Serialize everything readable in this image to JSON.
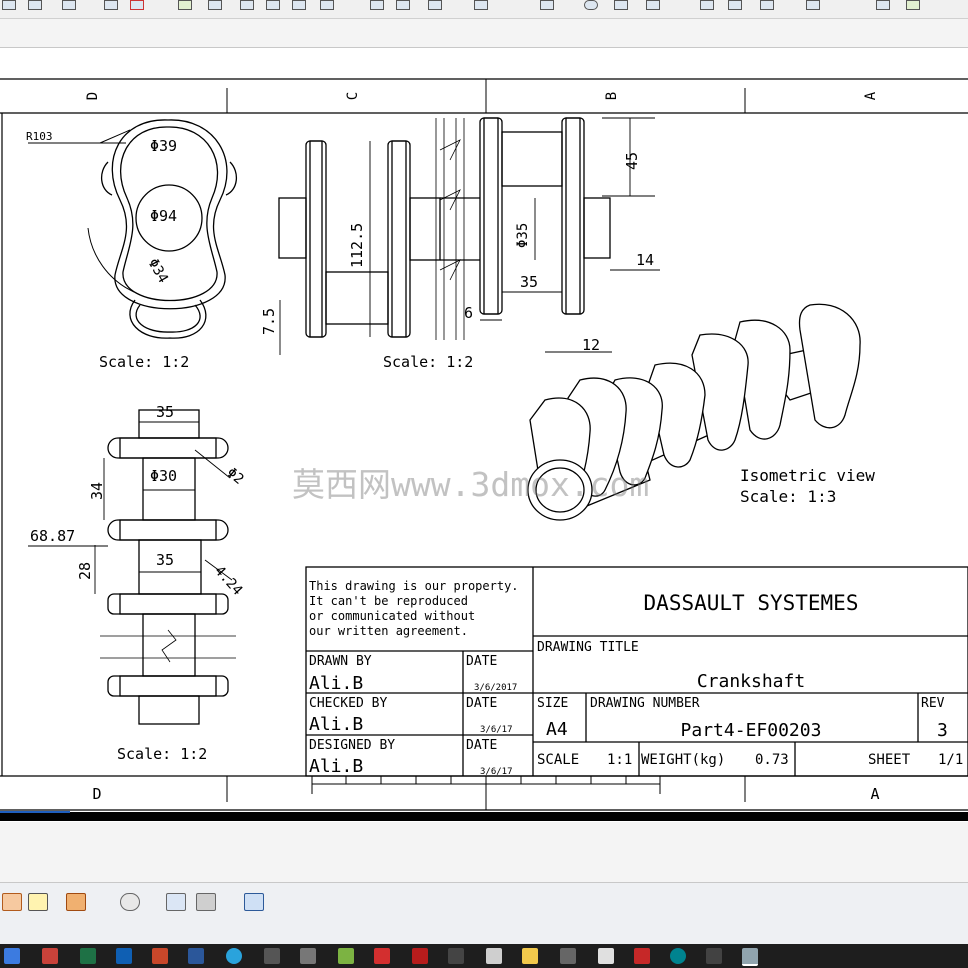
{
  "window": {
    "accent": "#1f5fbf"
  },
  "toolbar": {
    "icons": [
      "new-icon",
      "open-icon",
      "save-icon",
      "select-icon",
      "arrow-icon",
      "zoom-icon",
      "pan-icon",
      "rotate-icon",
      "view-icon",
      "measure-icon",
      "dimension-icon",
      "section-icon",
      "line-icon",
      "undo-icon",
      "copy-icon",
      "snap-icon",
      "circle-icon",
      "rectangle-icon",
      "spline-icon",
      "grid-icon",
      "layer-icon",
      "table-icon",
      "settings-icon",
      "window-icon",
      "help-icon"
    ]
  },
  "drawing": {
    "zones_top": [
      "D",
      "C",
      "B",
      "A"
    ],
    "zones_bottom": [
      "D",
      "A"
    ],
    "views": {
      "left_view": {
        "scale_label": "Scale:  1:2",
        "dims": {
          "r103": "R103",
          "d39": "Φ39",
          "d94": "Φ94",
          "d34": "Φ34"
        }
      },
      "front_view": {
        "scale_label": "Scale:  1:2",
        "dims": {
          "d112": "112.5",
          "d75": "7.5",
          "d6": "6",
          "d35": "35",
          "dphi35": "Φ35",
          "d45": "45",
          "d14": "14",
          "d12": "12"
        }
      },
      "top_view": {
        "scale_label": "Scale:  1:2",
        "dims": {
          "d35a": "35",
          "d30": "Φ30",
          "d2": "Φ2",
          "d34": "34",
          "d6887": "68.87",
          "d28": "28",
          "d35b": "35",
          "d424": "4.24"
        }
      },
      "iso_view": {
        "title": "Isometric view",
        "scale_label": "Scale:  1:3"
      }
    },
    "watermark": "莫西网www.3dmox.com",
    "title_block": {
      "note": [
        "This drawing is our property.",
        "It can't be reproduced",
        "or communicated without",
        "our written agreement."
      ],
      "company": "DASSAULT SYSTEMES",
      "drawing_title_label": "DRAWING TITLE",
      "drawing_title": "Crankshaft",
      "drawn_by_label": "DRAWN BY",
      "drawn_by": "Ali.B",
      "date_label": "DATE",
      "drawn_date": "3/6/2017",
      "checked_by_label": "CHECKED BY",
      "checked_by": "Ali.B",
      "checked_date": "3/6/17",
      "designed_by_label": "DESIGNED BY",
      "designed_by": "Ali.B",
      "designed_date": "3/6/17",
      "size_label": "SIZE",
      "size": "A4",
      "drawing_number_label": "DRAWING NUMBER",
      "drawing_number": "Part4-EF00203",
      "rev_label": "REV",
      "rev": "3",
      "scale_label": "SCALE",
      "scale": "1:1",
      "weight_label": "WEIGHT(kg)",
      "weight": "0.73",
      "sheet_label": "SHEET",
      "sheet": "1/1"
    }
  },
  "bottom_toolbar": {
    "icons": [
      "dimension-tool-icon",
      "geometry-tool-icon",
      "annotation-icon",
      "constraint-icon",
      "measure-tool-icon",
      "print-icon",
      "view-3d-icon"
    ]
  },
  "taskbar": {
    "icons": [
      "start-icon",
      "app-icon-1",
      "excel-icon",
      "outlook-icon",
      "powerpoint-icon",
      "word-icon",
      "telegram-icon",
      "calculator-icon",
      "image-icon",
      "android-icon",
      "catia-icon",
      "acrobat-icon",
      "network-icon",
      "notepad-icon",
      "folder-icon",
      "audio-icon",
      "app-icon-2",
      "app-icon-3",
      "archive-icon",
      "active-app-icon"
    ]
  }
}
